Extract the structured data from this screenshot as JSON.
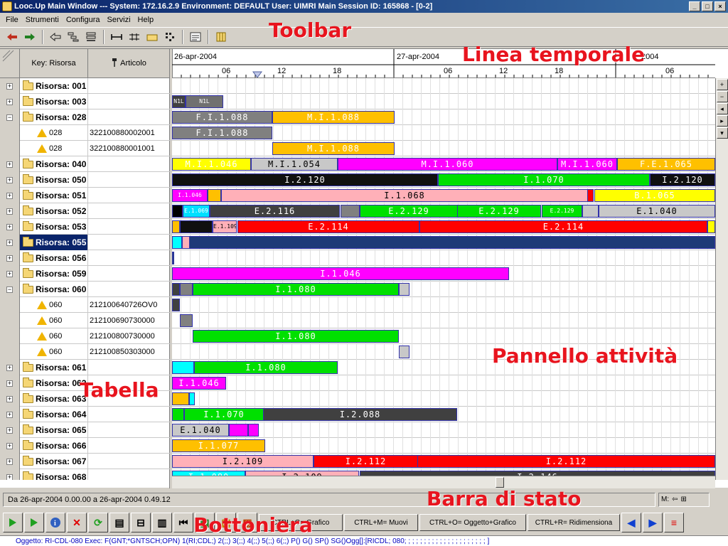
{
  "window": {
    "title": "Looc.Up Main Window  ---  System: 172.16.2.9 Environment: DEFAULT User: UIMRI Main Session ID: 165868 - [0-2]",
    "controls": [
      "_",
      "□",
      "×"
    ]
  },
  "menu": [
    "File",
    "Strumenti",
    "Configura",
    "Servizi",
    "Help"
  ],
  "toolbar": {
    "icons": [
      "arrow-left-icon",
      "arrow-right-icon",
      "back-icon",
      "hierarchy-icon",
      "stack-icon",
      "fit-width-icon",
      "fit-columns-icon",
      "folder-icon",
      "grid-icon",
      "report-icon",
      "columns-icon"
    ]
  },
  "annotations": {
    "toolbar": "Toolbar",
    "timeline": "Linea temporale",
    "panel": "Pannello attività",
    "table": "Tabella",
    "statusbar": "Barra di stato",
    "buttons": "Bottoniera"
  },
  "table": {
    "col_key": "Key: Risorsa",
    "col_article": "Articolo"
  },
  "timeline": {
    "dates": [
      "26-apr-2004",
      "27-apr-2004",
      "2004"
    ],
    "hours": [
      "06",
      "12",
      "18",
      "06",
      "12",
      "18",
      "06"
    ]
  },
  "rows": [
    {
      "expander": "+",
      "key": "Risorsa: 001",
      "article": "",
      "type": "parent",
      "bars": []
    },
    {
      "expander": "+",
      "key": "Risorsa: 003",
      "article": "",
      "type": "parent",
      "bars": [
        {
          "label": "N1L",
          "color": "#404040",
          "text": "#fff",
          "start": 0.0,
          "end": 0.025
        },
        {
          "label": "N1L",
          "color": "#707070",
          "text": "#fff",
          "start": 0.025,
          "end": 0.095
        }
      ]
    },
    {
      "expander": "−",
      "key": "Risorsa: 028",
      "article": "",
      "type": "parent",
      "bars": [
        {
          "label": "F.I.1.088",
          "color": "#808080",
          "text": "#fff",
          "start": 0.0,
          "end": 0.185
        },
        {
          "label": "M.I.1.088",
          "color": "#ffc000",
          "text": "#fff",
          "start": 0.185,
          "end": 0.41
        }
      ]
    },
    {
      "expander": "",
      "key": "028",
      "article": "322100880002001",
      "type": "child",
      "bars": [
        {
          "label": "F.I.1.088",
          "color": "#808080",
          "text": "#fff",
          "start": 0.0,
          "end": 0.185
        }
      ]
    },
    {
      "expander": "",
      "key": "028",
      "article": "322100880001001",
      "type": "child",
      "bars": [
        {
          "label": "M.I.1.088",
          "color": "#ffc000",
          "text": "#fff",
          "start": 0.185,
          "end": 0.41
        }
      ]
    },
    {
      "expander": "+",
      "key": "Risorsa: 040",
      "article": "",
      "type": "parent",
      "bars": [
        {
          "label": "M.I.1.046",
          "color": "#ffff00",
          "text": "#fff",
          "start": 0.0,
          "end": 0.145
        },
        {
          "label": "M.I.1.054",
          "color": "#c8c8c8",
          "text": "#000",
          "start": 0.145,
          "end": 0.305
        },
        {
          "label": "M.I.1.060",
          "color": "#ff00ff",
          "text": "#fff",
          "start": 0.305,
          "end": 0.71
        },
        {
          "label": "M.I.1.060",
          "color": "#ff00ff",
          "text": "#fff",
          "start": 0.71,
          "end": 0.82
        },
        {
          "label": "F.E.1.065",
          "color": "#ffc000",
          "text": "#fff",
          "start": 0.82,
          "end": 1.0
        }
      ]
    },
    {
      "expander": "+",
      "key": "Risorsa: 050",
      "article": "",
      "type": "parent",
      "bars": [
        {
          "label": "I.2.120",
          "color": "#101010",
          "text": "#fff",
          "start": 0.0,
          "end": 0.49
        },
        {
          "label": "I.1.070",
          "color": "#00e000",
          "text": "#fff",
          "start": 0.49,
          "end": 0.88
        },
        {
          "label": "I.2.120",
          "color": "#101010",
          "text": "#fff",
          "start": 0.88,
          "end": 1.0
        }
      ]
    },
    {
      "expander": "+",
      "key": "Risorsa: 051",
      "article": "",
      "type": "parent",
      "bars": [
        {
          "label": "I.1.046",
          "color": "#ff00ff",
          "text": "#fff",
          "start": 0.0,
          "end": 0.065
        },
        {
          "label": "",
          "color": "#ffc000",
          "text": "#fff",
          "start": 0.065,
          "end": 0.09
        },
        {
          "label": "I.1.068",
          "color": "#ffb0b8",
          "text": "#000",
          "start": 0.09,
          "end": 0.765
        },
        {
          "label": "",
          "color": "#ff0000",
          "text": "#fff",
          "start": 0.765,
          "end": 0.777
        },
        {
          "label": "B.1.065",
          "color": "#ffff00",
          "text": "#fff",
          "start": 0.777,
          "end": 1.0
        }
      ]
    },
    {
      "expander": "+",
      "key": "Risorsa: 052",
      "article": "",
      "type": "parent",
      "bars": [
        {
          "label": "",
          "color": "#000000",
          "text": "#fff",
          "start": 0.0,
          "end": 0.02
        },
        {
          "label": "E.1.069",
          "color": "#00e0ff",
          "text": "#fff",
          "start": 0.02,
          "end": 0.07
        },
        {
          "label": "E.2.116",
          "color": "#404040",
          "text": "#fff",
          "start": 0.07,
          "end": 0.31
        },
        {
          "label": "",
          "color": "#808080",
          "text": "#fff",
          "start": 0.31,
          "end": 0.345
        },
        {
          "label": "E.2.129",
          "color": "#00e000",
          "text": "#fff",
          "start": 0.345,
          "end": 0.525
        },
        {
          "label": "E.2.129",
          "color": "#00e000",
          "text": "#fff",
          "start": 0.525,
          "end": 0.68
        },
        {
          "label": "E.2.129",
          "color": "#00e000",
          "text": "#fff",
          "start": 0.68,
          "end": 0.755
        },
        {
          "label": "",
          "color": "#c8c8c8",
          "text": "#000",
          "start": 0.755,
          "end": 0.785
        },
        {
          "label": "E.1.040",
          "color": "#c8c8c8",
          "text": "#000",
          "start": 0.785,
          "end": 1.0
        }
      ]
    },
    {
      "expander": "+",
      "key": "Risorsa: 053",
      "article": "",
      "type": "parent",
      "bars": [
        {
          "label": "",
          "color": "#ffc000",
          "text": "#fff",
          "start": 0.0,
          "end": 0.015
        },
        {
          "label": "",
          "color": "#101010",
          "text": "#fff",
          "start": 0.015,
          "end": 0.075
        },
        {
          "label": "E.1.109",
          "color": "#ffb0b8",
          "text": "#000",
          "start": 0.075,
          "end": 0.12
        },
        {
          "label": "E.2.114",
          "color": "#ff0000",
          "text": "#fff",
          "start": 0.12,
          "end": 0.455
        },
        {
          "label": "E.2.114",
          "color": "#ff0000",
          "text": "#fff",
          "start": 0.455,
          "end": 0.985
        },
        {
          "label": "",
          "color": "#ffff00",
          "text": "#fff",
          "start": 0.985,
          "end": 1.0
        }
      ]
    },
    {
      "expander": "+",
      "key": "Risorsa: 055",
      "article": "",
      "type": "parent",
      "selected": true,
      "bars": [
        {
          "label": "",
          "color": "#00ffff",
          "text": "#fff",
          "start": 0.0,
          "end": 0.018
        },
        {
          "label": "",
          "color": "#ffb0b8",
          "text": "#fff",
          "start": 0.018,
          "end": 0.032
        },
        {
          "label": "",
          "color": "#1e3a78",
          "text": "#fff",
          "start": 0.032,
          "end": 1.0
        }
      ]
    },
    {
      "expander": "+",
      "key": "Risorsa: 056",
      "article": "",
      "type": "parent",
      "bars": [
        {
          "label": "",
          "color": "#1e3a78",
          "text": "#fff",
          "start": 0.0,
          "end": 0.004
        }
      ]
    },
    {
      "expander": "+",
      "key": "Risorsa: 059",
      "article": "",
      "type": "parent",
      "bars": [
        {
          "label": "I.1.046",
          "color": "#ff00ff",
          "text": "#fff",
          "start": 0.0,
          "end": 0.62
        }
      ]
    },
    {
      "expander": "−",
      "key": "Risorsa: 060",
      "article": "",
      "type": "parent",
      "bars": [
        {
          "label": "",
          "color": "#404040",
          "text": "#fff",
          "start": 0.0,
          "end": 0.014
        },
        {
          "label": "",
          "color": "#808080",
          "text": "#fff",
          "start": 0.014,
          "end": 0.038
        },
        {
          "label": "I.1.080",
          "color": "#00e000",
          "text": "#fff",
          "start": 0.038,
          "end": 0.418
        },
        {
          "label": "",
          "color": "#c8c8c8",
          "text": "#000",
          "start": 0.418,
          "end": 0.437
        }
      ]
    },
    {
      "expander": "",
      "key": "060",
      "article": "212100640726OV0",
      "type": "child",
      "bars": [
        {
          "label": "",
          "color": "#404040",
          "text": "#fff",
          "start": 0.0,
          "end": 0.014
        }
      ]
    },
    {
      "expander": "",
      "key": "060",
      "article": "212100690730000",
      "type": "child",
      "bars": [
        {
          "label": "",
          "color": "#808080",
          "text": "#fff",
          "start": 0.014,
          "end": 0.038
        }
      ]
    },
    {
      "expander": "",
      "key": "060",
      "article": "212100800730000",
      "type": "child",
      "bars": [
        {
          "label": "I.1.080",
          "color": "#00e000",
          "text": "#fff",
          "start": 0.038,
          "end": 0.418
        }
      ]
    },
    {
      "expander": "",
      "key": "060",
      "article": "212100850303000",
      "type": "child",
      "bars": [
        {
          "label": "",
          "color": "#c8c8c8",
          "text": "#000",
          "start": 0.418,
          "end": 0.437
        }
      ]
    },
    {
      "expander": "+",
      "key": "Risorsa: 061",
      "article": "",
      "type": "parent",
      "bars": [
        {
          "label": "",
          "color": "#00ffff",
          "text": "#fff",
          "start": 0.0,
          "end": 0.04
        },
        {
          "label": "I.1.080",
          "color": "#00e000",
          "text": "#fff",
          "start": 0.04,
          "end": 0.305
        }
      ]
    },
    {
      "expander": "+",
      "key": "Risorsa: 062",
      "article": "",
      "type": "parent",
      "bars": [
        {
          "label": "I.1.046",
          "color": "#ff00ff",
          "text": "#fff",
          "start": 0.0,
          "end": 0.1
        }
      ]
    },
    {
      "expander": "+",
      "key": "Risorsa: 063",
      "article": "",
      "type": "parent",
      "bars": [
        {
          "label": "",
          "color": "#ffc000",
          "text": "#fff",
          "start": 0.0,
          "end": 0.032
        },
        {
          "label": "",
          "color": "#00ffff",
          "text": "#fff",
          "start": 0.032,
          "end": 0.043
        }
      ]
    },
    {
      "expander": "+",
      "key": "Risorsa: 064",
      "article": "",
      "type": "parent",
      "bars": [
        {
          "label": "",
          "color": "#00e000",
          "text": "#fff",
          "start": 0.0,
          "end": 0.022
        },
        {
          "label": "I.1.070",
          "color": "#00e000",
          "text": "#fff",
          "start": 0.022,
          "end": 0.168
        },
        {
          "label": "I.2.088",
          "color": "#404040",
          "text": "#fff",
          "start": 0.168,
          "end": 0.525
        }
      ]
    },
    {
      "expander": "+",
      "key": "Risorsa: 065",
      "article": "",
      "type": "parent",
      "bars": [
        {
          "label": "E.1.040",
          "color": "#c8c8c8",
          "text": "#000",
          "start": 0.0,
          "end": 0.105
        },
        {
          "label": "",
          "color": "#ff00ff",
          "text": "#fff",
          "start": 0.105,
          "end": 0.14
        },
        {
          "label": "",
          "color": "#ff00ff",
          "text": "#fff",
          "start": 0.14,
          "end": 0.16
        }
      ]
    },
    {
      "expander": "+",
      "key": "Risorsa: 066",
      "article": "",
      "type": "parent",
      "bars": [
        {
          "label": "I.1.077",
          "color": "#ffc000",
          "text": "#fff",
          "start": 0.0,
          "end": 0.172
        }
      ]
    },
    {
      "expander": "+",
      "key": "Risorsa: 067",
      "article": "",
      "type": "parent",
      "bars": [
        {
          "label": "I.2.109",
          "color": "#ffb0b8",
          "text": "#000",
          "start": 0.0,
          "end": 0.26
        },
        {
          "label": "I.2.112",
          "color": "#ff0000",
          "text": "#fff",
          "start": 0.26,
          "end": 0.452
        },
        {
          "label": "I.2.112",
          "color": "#ff0000",
          "text": "#fff",
          "start": 0.452,
          "end": 1.0
        }
      ]
    },
    {
      "expander": "+",
      "key": "Risorsa: 068",
      "article": "",
      "type": "parent",
      "bars": [
        {
          "label": "I.1.080",
          "color": "#00ffff",
          "text": "#fff",
          "start": 0.0,
          "end": 0.135
        },
        {
          "label": "I.2.109",
          "color": "#ffb0b8",
          "text": "#000",
          "start": 0.135,
          "end": 0.345
        },
        {
          "label": "I.2.146",
          "color": "#404040",
          "text": "#fff",
          "start": 0.345,
          "end": 1.0
        }
      ]
    }
  ],
  "status": {
    "text": "Da 26-apr-2004 0.00.00 a 26-apr-2004 0.49.12",
    "mode": "M:"
  },
  "bottom_buttons": {
    "shortcuts": [
      "CTRL+G= Grafico",
      "CTRL+M= Muovi",
      "CTRL+O= Oggetto+Grafico",
      "CTRL+R= Ridimensiona"
    ]
  },
  "infobar": "Oggetto: RI-CDL-080 Exec: F(GNT;*GNTSCH;OPN) 1(RI;CDL;) 2(;;) 3(;;) 4(;;) 5(;;) 6(;;) P() G() SP() SG()Ogg[]:[RICDL; 080; ; ; ; ; ; ; ; ; ; ; ; ; ; ; ; ; ; ; ; ; ]"
}
